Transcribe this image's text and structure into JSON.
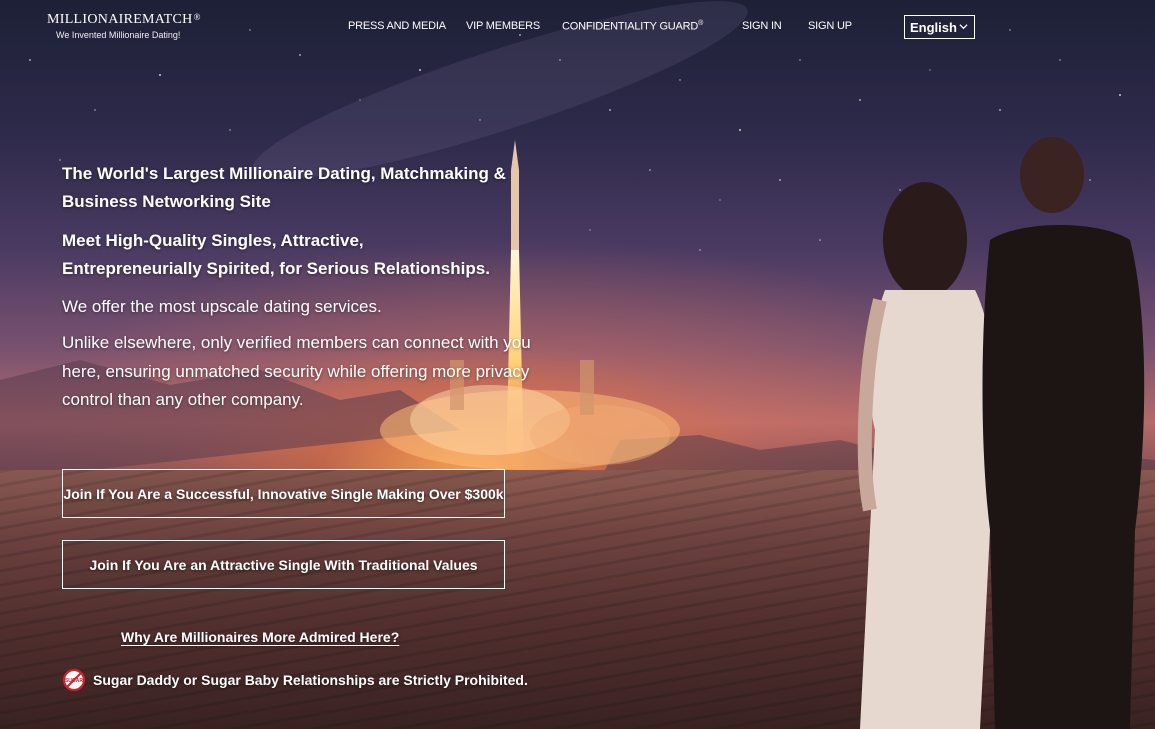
{
  "header": {
    "logo_name": "MILLIONAIREMATCH",
    "logo_reg": "®",
    "logo_tagline": "We Invented Millionaire Dating!",
    "nav": {
      "press": "PRESS AND MEDIA",
      "vip": "VIP MEMBERS",
      "confidentiality": "CONFIDENTIALITY GUARD",
      "confidentiality_reg": "®",
      "sign_in": "SIGN IN",
      "sign_up": "SIGN UP"
    },
    "language": {
      "selected": "English",
      "icon": "chevron-down-icon"
    }
  },
  "hero": {
    "headline": "The World's Largest Millionaire Dating, Matchmaking & Business Networking Site",
    "subheadline": "Meet High-Quality Singles, Attractive, Entrepreneurially Spirited, for Serious Relationships.",
    "offer": "We offer the most upscale dating services.",
    "description": "Unlike elsewhere, only verified members can connect with you here, ensuring unmatched security while offering more privacy control than any other company.",
    "buttons": {
      "join_successful": "Join If You Are a Successful, Innovative Single Making Over $300k",
      "join_attractive": "Join If You Are an Attractive Single With Traditional Values"
    },
    "why_link": "Why Are Millionaires More Admired Here?",
    "notice": {
      "icon": "no-sugar-icon",
      "icon_text": "SUGAR",
      "text": "Sugar Daddy or Sugar Baby Relationships are Strictly Prohibited."
    }
  },
  "colors": {
    "text": "#ffffff",
    "prohibited_red": "#d0202a"
  }
}
